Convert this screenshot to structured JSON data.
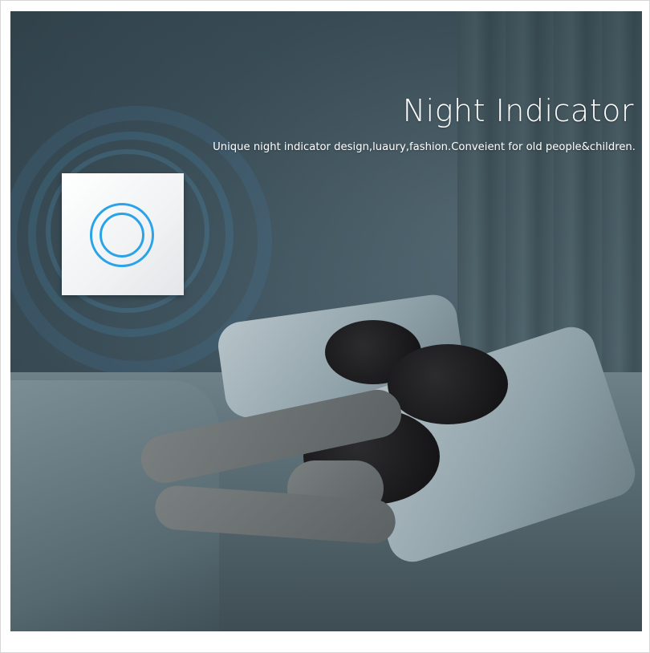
{
  "product_image": {
    "title": "Night Indicator",
    "subtitle": "Unique night indicator design,luaury,fashion.Conveient for old people&children.",
    "indicator_color": "#2aa3e8",
    "scene": "bedroom-at-night"
  }
}
